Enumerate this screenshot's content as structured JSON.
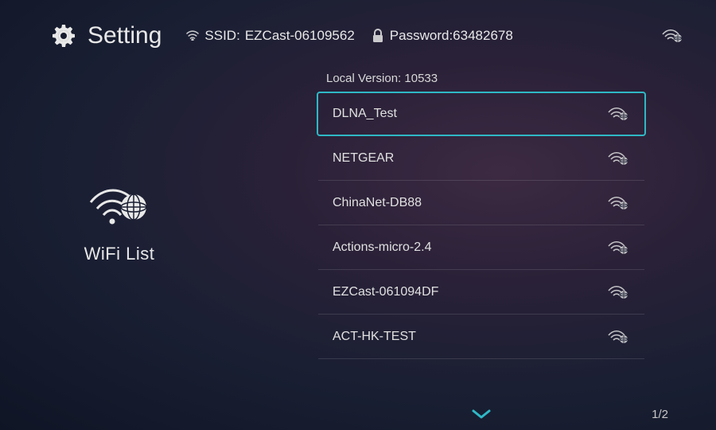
{
  "header": {
    "title": "Setting",
    "ssid_label": "SSID:",
    "ssid_value": "EZCast-06109562",
    "password_label": "Password:",
    "password_value": "63482678"
  },
  "sidebar": {
    "label": "WiFi List"
  },
  "local_version_label": "Local Version:",
  "local_version_value": "10533",
  "networks": [
    {
      "name": "DLNA_Test",
      "selected": true
    },
    {
      "name": "NETGEAR",
      "selected": false
    },
    {
      "name": "ChinaNet-DB88",
      "selected": false
    },
    {
      "name": "Actions-micro-2.4",
      "selected": false
    },
    {
      "name": "EZCast-061094DF",
      "selected": false
    },
    {
      "name": "ACT-HK-TEST",
      "selected": false
    }
  ],
  "page_indicator": "1/2"
}
